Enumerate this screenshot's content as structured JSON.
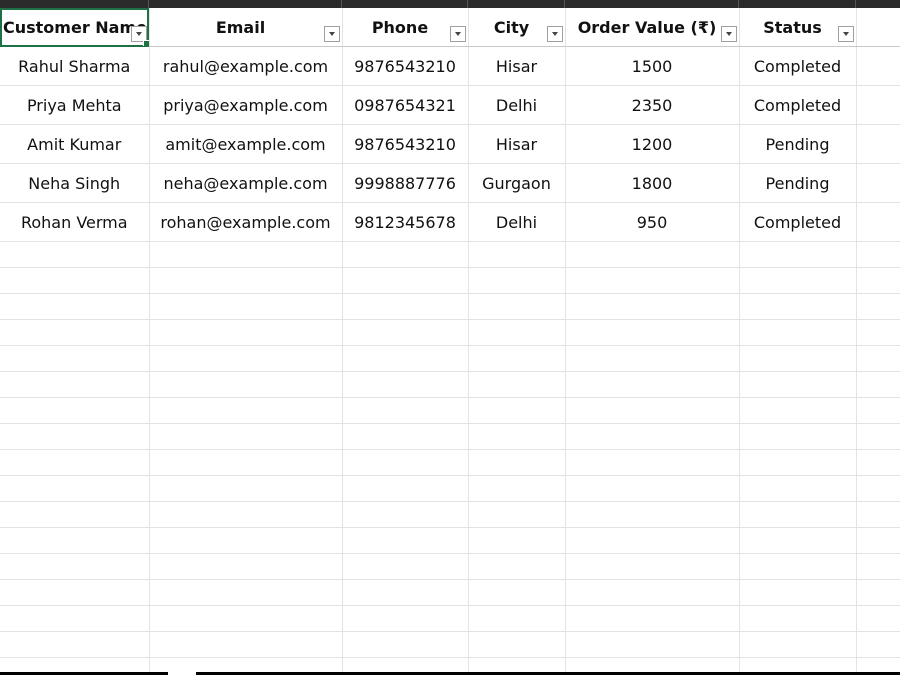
{
  "table": {
    "headers": [
      "Customer Name",
      "Email",
      "Phone",
      "City",
      "Order Value (₹)",
      "Status"
    ],
    "rows": [
      [
        "Rahul Sharma",
        "rahul@example.com",
        "9876543210",
        "Hisar",
        "1500",
        "Completed"
      ],
      [
        "Priya Mehta",
        "priya@example.com",
        "0987654321",
        "Delhi",
        "2350",
        "Completed"
      ],
      [
        "Amit Kumar",
        "amit@example.com",
        "9876543210",
        "Hisar",
        "1200",
        "Pending"
      ],
      [
        "Neha Singh",
        "neha@example.com",
        "9998887776",
        "Gurgaon",
        "1800",
        "Pending"
      ],
      [
        "Rohan Verma",
        "rohan@example.com",
        "9812345678",
        "Delhi",
        "950",
        "Completed"
      ]
    ],
    "filter_icon": "dropdown-arrow-icon"
  },
  "colors": {
    "selection": "#1e7145",
    "gridline": "#e3e3e3"
  }
}
